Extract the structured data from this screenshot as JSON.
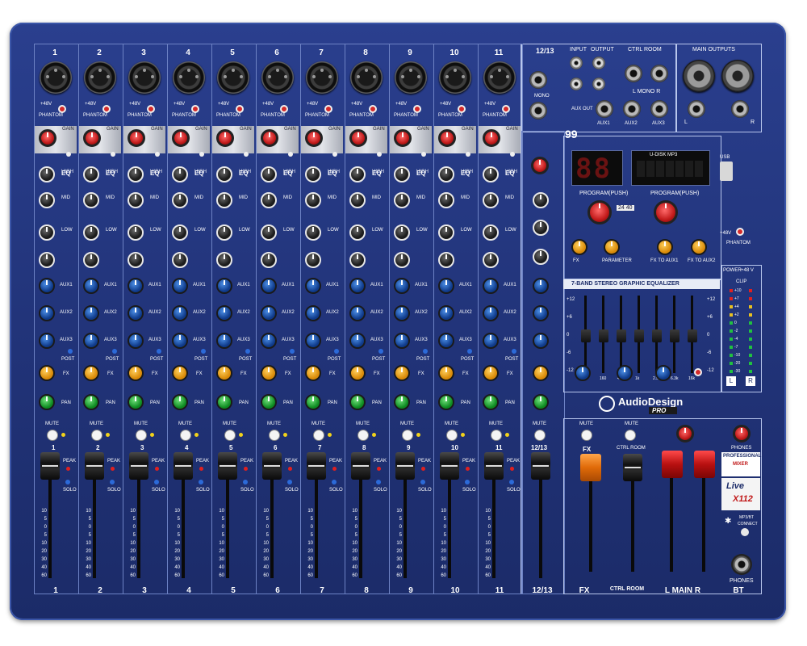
{
  "brand": {
    "name": "AudioDesign",
    "suffix": "PRO"
  },
  "channels": [
    "1",
    "2",
    "3",
    "4",
    "5",
    "6",
    "7",
    "8",
    "9",
    "10",
    "11"
  ],
  "stereo_channel": "12/13",
  "channel_strip": {
    "phantom_top": "+48V",
    "phantom": "PHANTOM",
    "gain": "GAIN",
    "eq": "EQ",
    "high": "HIGH",
    "mid": "MID",
    "low": "LOW",
    "aux1": "AUX1",
    "aux2": "AUX2",
    "aux3": "AUX3",
    "post": "POST",
    "fx": "FX",
    "pan": "PAN",
    "mute": "MUTE",
    "peak": "PEAK",
    "solo": "SOLO",
    "mono": "MONO"
  },
  "fader_scale": [
    "10",
    "5",
    "0",
    "5",
    "10",
    "20",
    "30",
    "40",
    "60"
  ],
  "io": {
    "input": "INPUT",
    "output": "OUTPUT",
    "ctrl_room": "CTRL ROOM",
    "main_outputs": "MAIN OUTPUTS",
    "l_mono_r": "L  MONO  R",
    "aux_out": "AUX OUT",
    "aux_labels": [
      "AUX1",
      "AUX2",
      "AUX3"
    ],
    "l": "L",
    "r": "R"
  },
  "effects": {
    "preset_count": "99",
    "display_digits": "88",
    "usb_display": "U-DISK MP3",
    "usb": "USB",
    "program_push": "PROGRAM(PUSH)",
    "bit_label": "24 40",
    "parameter": "PARAMETER",
    "fx_label": "FX",
    "fx_to_aux": "FX TO AUX1",
    "fx_to_aux2": "FX TO AUX2",
    "phantom": "PHANTOM",
    "plus48": "+48V"
  },
  "graphic_eq": {
    "title": "7-BAND STEREO GRAPHIC EQUALIZER",
    "bands": [
      "63",
      "160",
      "400",
      "1k",
      "2.5k",
      "6.3k",
      "16k"
    ],
    "scale": [
      "+12",
      "+6",
      "0",
      "-6",
      "-12"
    ]
  },
  "meter": {
    "power": "POWER",
    "plus48": "+48 V",
    "clip": "CLIP",
    "scale": [
      "+10",
      "+7",
      "+4",
      "+2",
      "0",
      "-2",
      "-4",
      "-7",
      "-10",
      "-20",
      "-30"
    ]
  },
  "bottom_labels": [
    "1",
    "2",
    "3",
    "4",
    "5",
    "6",
    "7",
    "8",
    "9",
    "10",
    "11",
    "12/13",
    "FX",
    "CTRL ROOM",
    "L  MAIN  R",
    "BT"
  ],
  "right_panel": {
    "phones": "PHONES",
    "professional": "PROFESSIONAL",
    "mixer": "MIXER",
    "live": "Live",
    "x112": "X112",
    "mp3bt": "MP3/BT",
    "connect": "CONNECT",
    "phones_bottom": "PHONES",
    "fx_section": "FX",
    "ctrl_section": "CTRL ROOM",
    "main": "MAIN"
  },
  "colors": {
    "panel": "#213378",
    "gain_knob": "#c11a1a",
    "aux_knob": "#0f3a8a",
    "fx_knob": "#d98a08",
    "pan_knob": "#0d8a20",
    "main_fader": "#b81010",
    "fx_fader": "#e06a08"
  }
}
